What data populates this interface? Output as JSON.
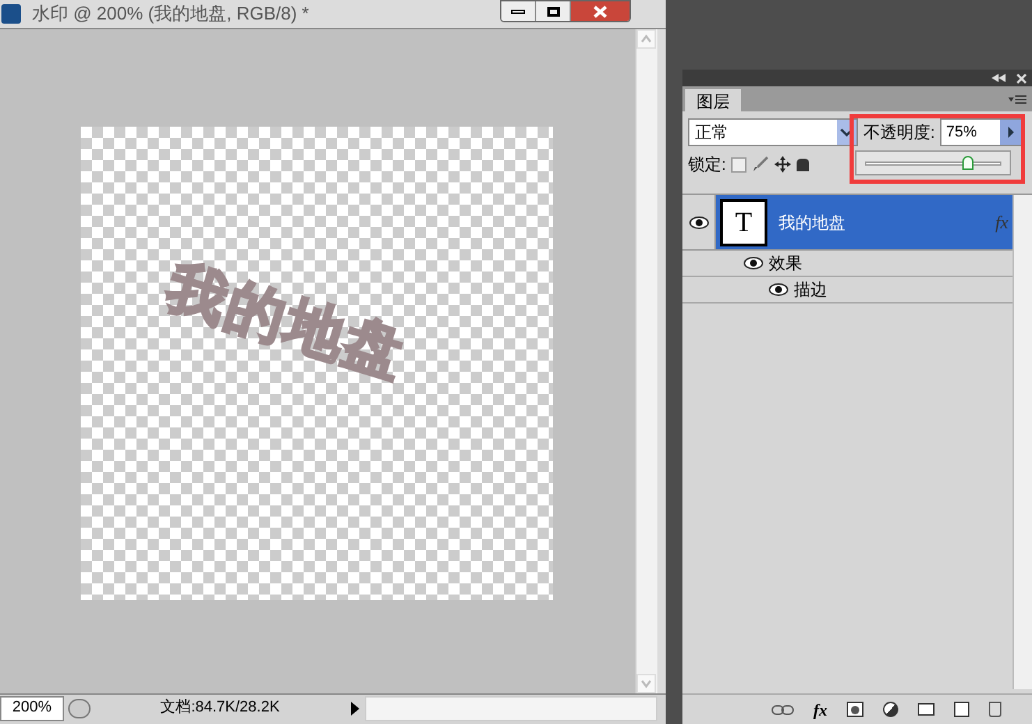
{
  "document_window": {
    "title": "水印 @ 200% (我的地盘, RGB/8) *",
    "canvas_text": "我的地盘",
    "status_bar": {
      "zoom": "200%",
      "doc_info": "文档:84.7K/28.2K"
    }
  },
  "layers_panel": {
    "tab": {
      "label": "图层",
      "selected": true
    },
    "blend_mode": "正常",
    "opacity_label": "不透明度:",
    "opacity_value": "75%",
    "opacity_slider": {
      "level": 0.75
    },
    "highlighted": true,
    "lock_label": "锁定:",
    "layers": [
      {
        "name": "我的地盘",
        "visible": true,
        "selected": true,
        "thumbnail_glyph": "T",
        "fx": "fx",
        "children": [
          {
            "name": "效果",
            "visible": true,
            "children": [
              {
                "name": "描边",
                "visible": true
              }
            ]
          }
        ]
      }
    ],
    "footer_fx": "fx"
  }
}
